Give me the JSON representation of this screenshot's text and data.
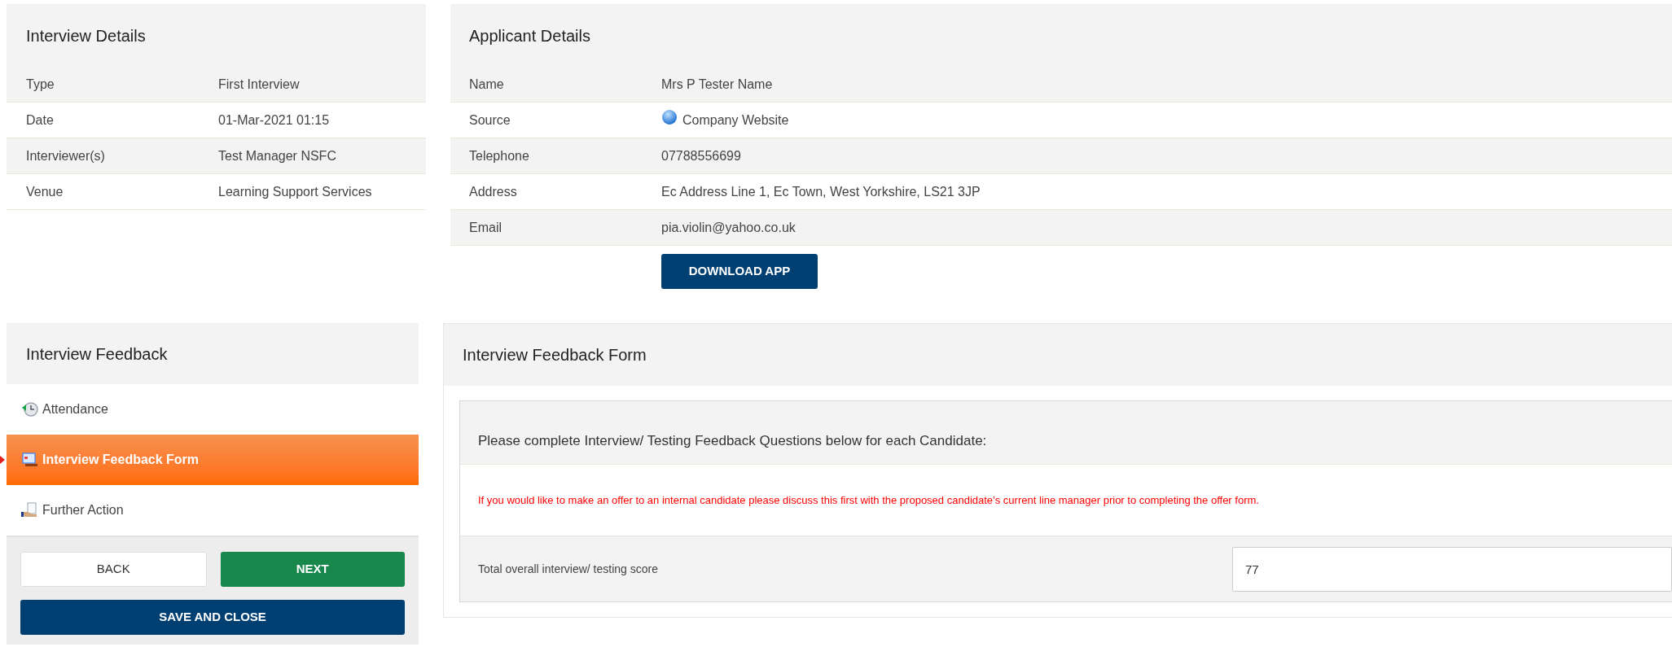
{
  "interview_details": {
    "title": "Interview Details",
    "rows": [
      {
        "label": "Type",
        "value": "First Interview"
      },
      {
        "label": "Date",
        "value": "01-Mar-2021 01:15"
      },
      {
        "label": "Interviewer(s)",
        "value": "Test Manager NSFC"
      },
      {
        "label": "Venue",
        "value": "Learning Support Services"
      }
    ]
  },
  "applicant_details": {
    "title": "Applicant Details",
    "rows": [
      {
        "label": "Name",
        "value": "Mrs P Tester Name",
        "kind": "text"
      },
      {
        "label": "Source",
        "value": "Company Website",
        "kind": "source"
      },
      {
        "label": "Telephone",
        "value": "07788556699",
        "kind": "text"
      },
      {
        "label": "Address",
        "value": "Ec Address Line 1, Ec Town, West Yorkshire, LS21 3JP",
        "kind": "text"
      },
      {
        "label": "Email",
        "value": "pia.violin@yahoo.co.uk",
        "kind": "text"
      }
    ],
    "download_button": "DOWNLOAD APP"
  },
  "interview_feedback": {
    "title": "Interview Feedback",
    "steps": [
      {
        "label": "Attendance",
        "kind": "attendance",
        "selected": false
      },
      {
        "label": "Interview Feedback Form",
        "kind": "form",
        "selected": true
      },
      {
        "label": "Further Action",
        "kind": "action",
        "selected": false
      }
    ],
    "back_button": "BACK",
    "next_button": "NEXT",
    "save_button": "SAVE AND CLOSE"
  },
  "feedback_form": {
    "title": "Interview Feedback Form",
    "instructions": "Please complete Interview/ Testing Feedback Questions below for each Candidate:",
    "warning": "If you would like to make an offer to an internal candidate please discuss this first with the proposed candidate’s current line manager prior to completing the offer form.",
    "score_label": "Total overall interview/ testing score",
    "score_value": "77"
  }
}
